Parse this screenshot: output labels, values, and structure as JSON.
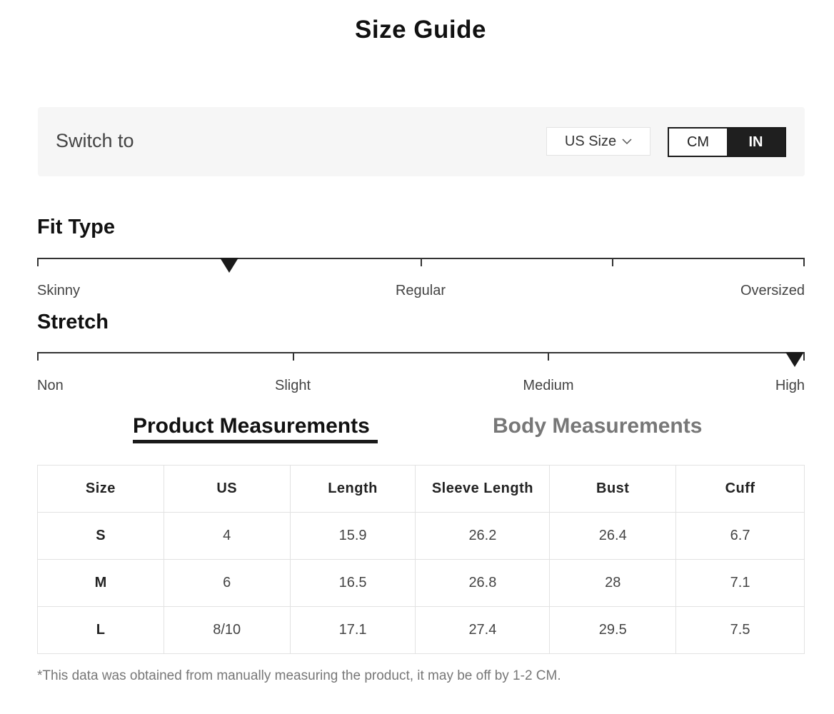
{
  "title": "Size Guide",
  "switch_bar": {
    "label": "Switch to",
    "size_select": "US Size",
    "units": [
      {
        "label": "CM",
        "active": false
      },
      {
        "label": "IN",
        "active": true
      }
    ]
  },
  "fit_type": {
    "heading": "Fit Type",
    "labels": [
      "Skinny",
      "Regular",
      "Oversized"
    ],
    "level": 0.25
  },
  "stretch": {
    "heading": "Stretch",
    "labels": [
      "Non",
      "Slight",
      "Medium",
      "High"
    ],
    "level": 1.0
  },
  "measure_tabs": [
    {
      "label": "Product Measurements",
      "active": true
    },
    {
      "label": "Body Measurements",
      "active": false
    }
  ],
  "table": {
    "headers": [
      "Size",
      "US",
      "Length",
      "Sleeve Length",
      "Bust",
      "Cuff"
    ],
    "rows": [
      [
        "S",
        "4",
        "15.9",
        "26.2",
        "26.4",
        "6.7"
      ],
      [
        "M",
        "6",
        "16.5",
        "26.8",
        "28",
        "7.1"
      ],
      [
        "L",
        "8/10",
        "17.1",
        "27.4",
        "29.5",
        "7.5"
      ]
    ]
  },
  "note": "*This data was obtained from manually measuring the product, it may be off by 1-2 CM.",
  "colors": {
    "accent": "#1f1f1f",
    "muted": "#777777"
  }
}
